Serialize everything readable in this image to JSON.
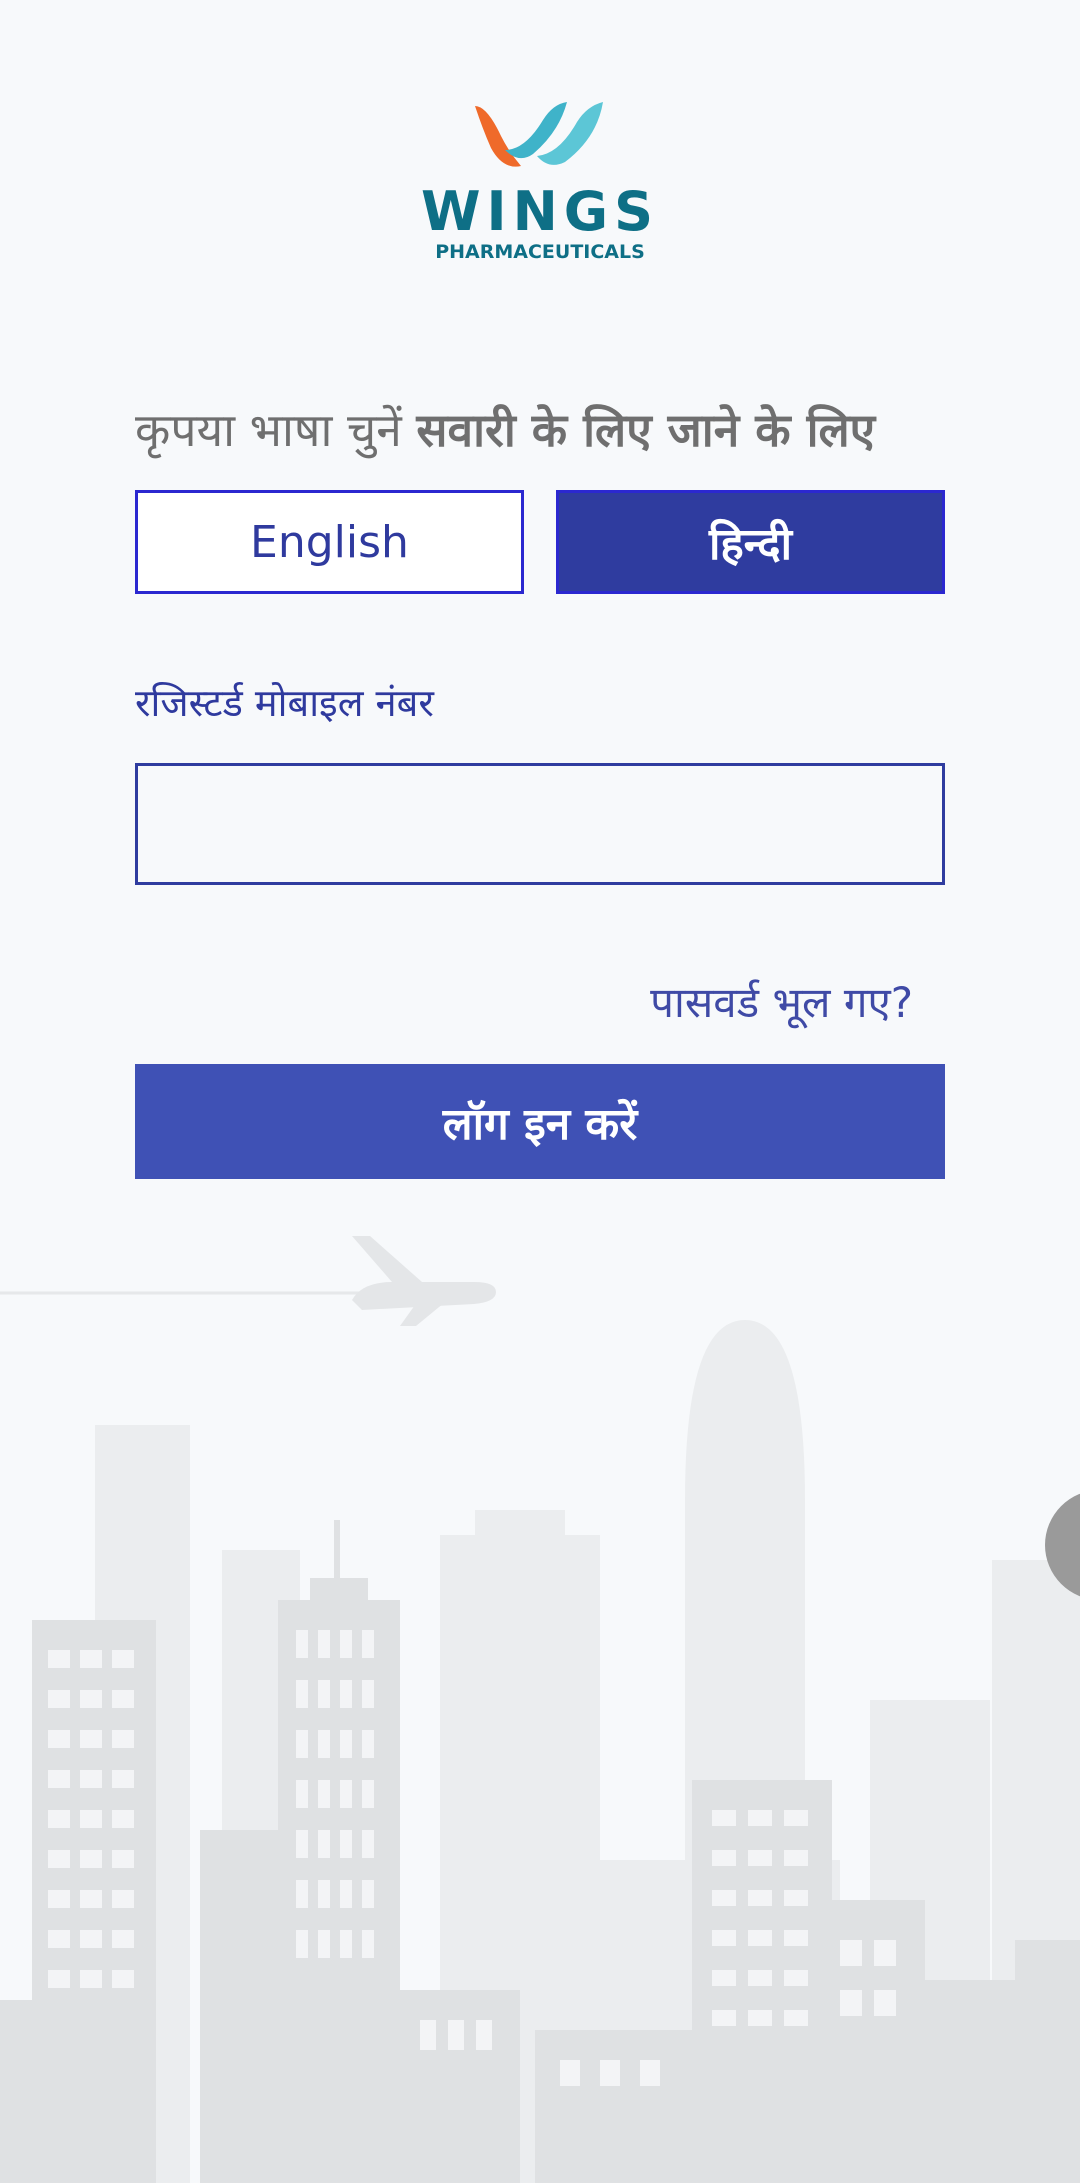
{
  "logo": {
    "wordmark": "WINGS",
    "subtitle": "PHARMACEUTICALS",
    "colors": {
      "orange": "#ef6a2a",
      "teal": "#3fb3c9",
      "text": "#0e6f86"
    }
  },
  "language": {
    "prompt_regular": "कृपया भाषा चुनें",
    "prompt_bold": "सवारी के लिए जाने के लिए",
    "options": [
      {
        "label": "English",
        "selected": false
      },
      {
        "label": "हिन्दी",
        "selected": true
      }
    ]
  },
  "mobile": {
    "label": "रजिस्टर्ड मोबाइल नंबर",
    "value": "",
    "placeholder": ""
  },
  "forgot_password": "पासवर्ड भूल गए?",
  "login_button": "लॉग इन करें",
  "colors": {
    "accent": "#3f51b5",
    "accent_dark": "#2f3c9f",
    "border": "#2b28d0",
    "background": "#f7f9fb"
  }
}
